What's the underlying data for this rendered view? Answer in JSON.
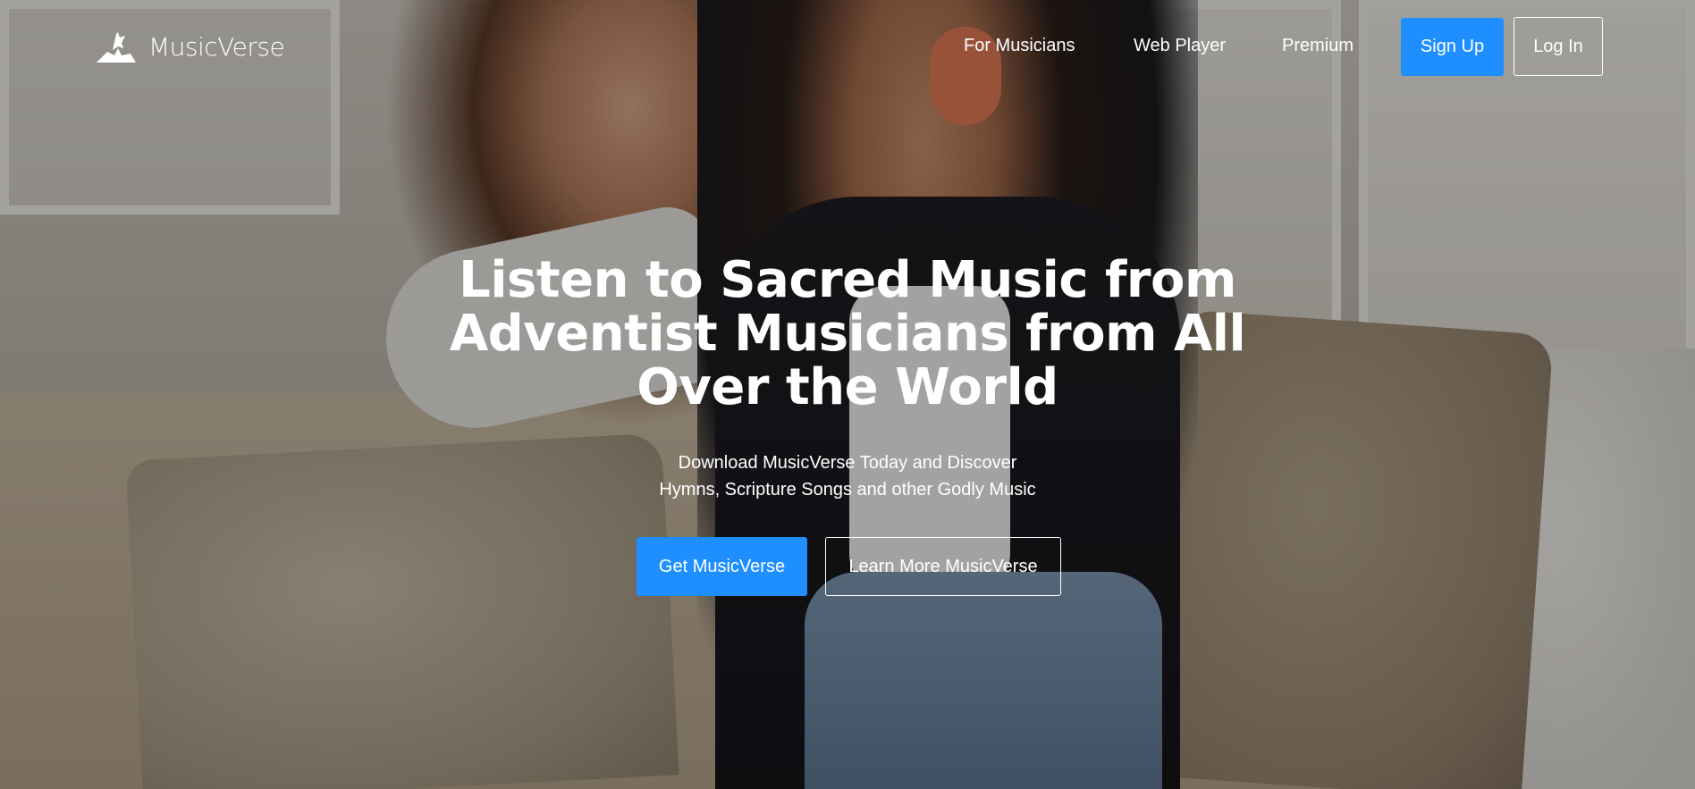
{
  "brand": {
    "name": "MusicVerse",
    "logo_icon": "hands-dove-icon"
  },
  "nav": {
    "items": [
      {
        "label": "For Musicians"
      },
      {
        "label": "Web Player"
      },
      {
        "label": "Premium"
      }
    ],
    "signup_label": "Sign Up",
    "login_label": "Log In"
  },
  "hero": {
    "headline_lines": [
      "Listen to Sacred Music from",
      "Adventist Musicians from All",
      "Over the World"
    ],
    "subtitle_lines": [
      "Download MusicVerse Today and Discover",
      "Hymns, Scripture Songs and other Godly Music"
    ],
    "primary_cta": "Get MusicVerse",
    "secondary_cta": "Learn More MusicVerse"
  },
  "colors": {
    "accent": "#1f8fff",
    "text": "#ffffff"
  }
}
